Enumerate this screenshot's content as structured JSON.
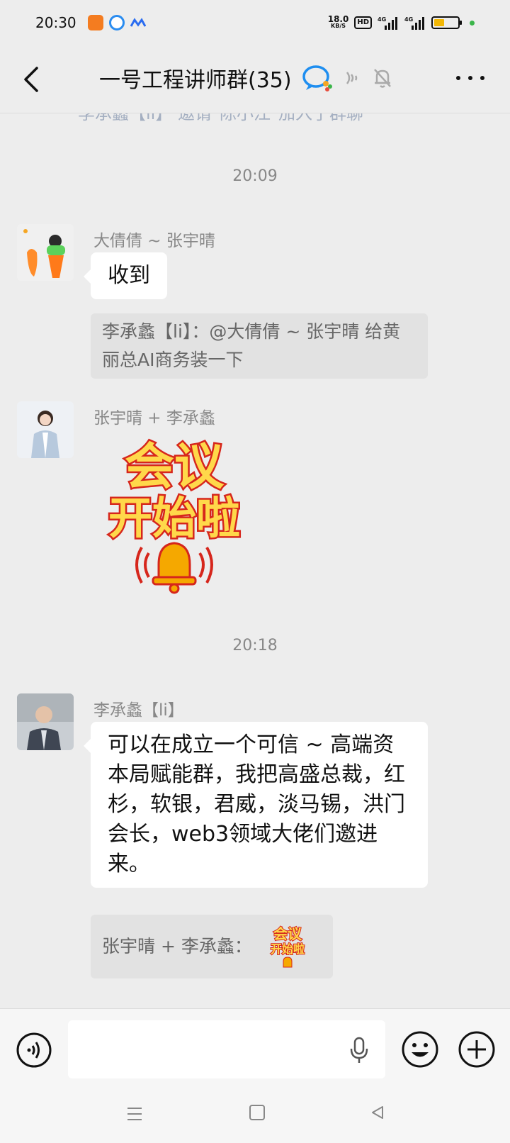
{
  "status_bar": {
    "time": "20:30",
    "net_speed_value": "18.0",
    "net_speed_unit": "KB/S",
    "hd_label": "HD",
    "signal1_label": "4G",
    "signal2_label": "4G"
  },
  "header": {
    "title": "一号工程讲师群(35)"
  },
  "chat": {
    "system_message": "李承蠡【li】 邀请\"陈小江\"加入了群聊",
    "time_1": "20:09",
    "time_2": "20:18",
    "messages": [
      {
        "sender": "大倩倩 ~ 张宇晴",
        "text": "收到",
        "quote": "李承蠡【li】：@大倩倩 ~ 张宇晴 给黄丽总AI商务装一下"
      },
      {
        "sender": "张宇晴 + 李承蠡",
        "sticker_line1": "会议",
        "sticker_line2": "开始啦"
      },
      {
        "sender": "李承蠡【li】",
        "text": "可以在成立一个可信 ~ 高端资本局赋能群，我把高盛总裁，红杉，软银，君威，淡马锡，洪门会长，web3领域大佬们邀进来。",
        "quote_prefix": "张宇晴 + 李承蠡：",
        "quote_sticker_line1": "会议",
        "quote_sticker_line2": "开始啦"
      }
    ]
  },
  "input_bar": {
    "placeholder": ""
  },
  "colors": {
    "background": "#ededed",
    "bubble": "#ffffff",
    "quote_bg": "#e2e2e2",
    "sticker_red": "#d6261c",
    "sticker_yellow": "#ffd84a",
    "sticker_purple": "#6a2c91",
    "bell_gold": "#f5a800"
  }
}
